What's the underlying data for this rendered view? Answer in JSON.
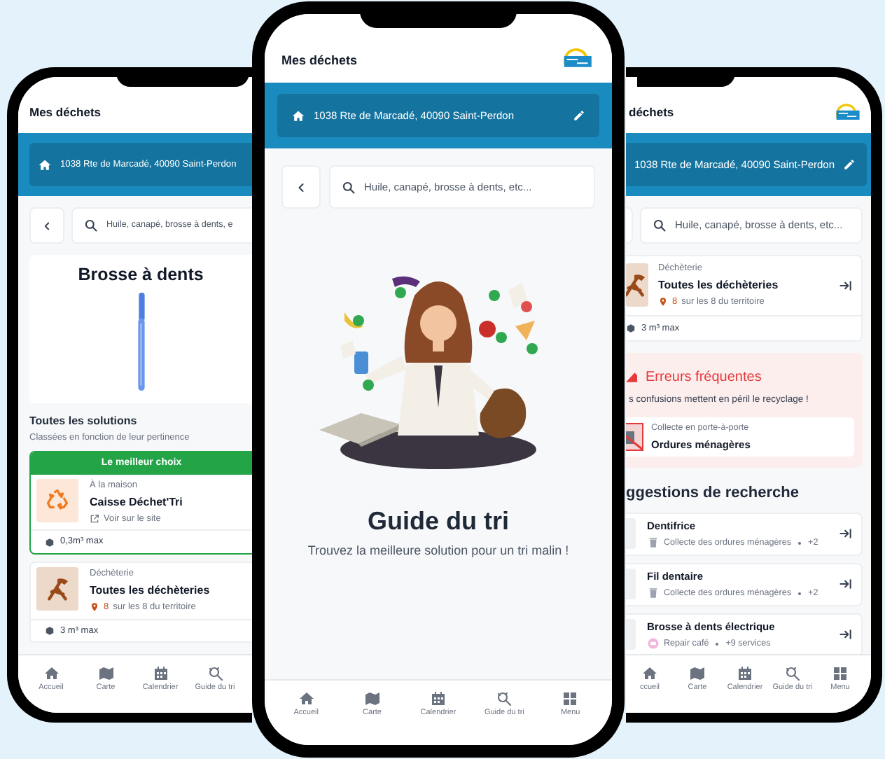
{
  "left_phone": {
    "title": "Mes déchets",
    "address": "1038 Rte de Marcadé, 40090 Saint-Perdon",
    "search_placeholder": "Huile, canapé, brosse à dents, e",
    "item_title": "Brosse à dents",
    "solutions_heading": "Toutes les solutions",
    "solutions_subheading": "Classées en fonction de leur pertinence",
    "solutions": [
      {
        "kind": "home",
        "badge": "Le meilleur choix",
        "category": "À la maison",
        "name": "Caisse Déchet'Tri",
        "link": "Voir sur le site",
        "capacity": "0,3m³ max"
      },
      {
        "kind": "center",
        "category": "Déchèterie",
        "name": "Toutes les déchèteries",
        "count": "8",
        "count_suffix": "sur les 8 du territoire",
        "capacity": "3 m³ max"
      }
    ],
    "nav": [
      "Accueil",
      "Carte",
      "Calendrier",
      "Guide du tri"
    ]
  },
  "center_phone": {
    "title": "Mes déchets",
    "address": "1038 Rte de Marcadé, 40090 Saint-Perdon",
    "search_placeholder": "Huile, canapé, brosse à dents, etc...",
    "heading": "Guide du tri",
    "subheading": "Trouvez la meilleure solution pour un tri malin !",
    "nav": [
      "Accueil",
      "Carte",
      "Calendrier",
      "Guide du tri",
      "Menu"
    ]
  },
  "right_phone": {
    "title": "déchets",
    "address": "1038 Rte de Marcadé, 40090 Saint-Perdon",
    "search_placeholder": "Huile, canapé, brosse à dents, etc...",
    "facility": {
      "category": "Déchèterie",
      "name": "Toutes les déchèteries",
      "count": "8",
      "count_suffix": "sur les 8 du territoire",
      "capacity": "3 m³ max"
    },
    "errors": {
      "title": "Erreurs fréquentes",
      "text": "s confusions mettent en péril le recyclage !",
      "item": {
        "category": "Collecte en porte-à-porte",
        "name": "Ordures ménagères"
      }
    },
    "suggestions_heading": "ggestions de recherche",
    "suggestions": [
      {
        "kind": "trash",
        "name": "Dentifrice",
        "service": "Collecte des ordures ménagères",
        "extra": "+2"
      },
      {
        "kind": "trash",
        "name": "Fil dentaire",
        "service": "Collecte des ordures ménagères",
        "extra": "+2"
      },
      {
        "kind": "repair",
        "name": "Brosse à dents électrique",
        "service": "Repair café",
        "extra": "+9 services"
      }
    ],
    "nav": [
      "ccueil",
      "Carte",
      "Calendrier",
      "Guide du tri",
      "Menu"
    ]
  }
}
